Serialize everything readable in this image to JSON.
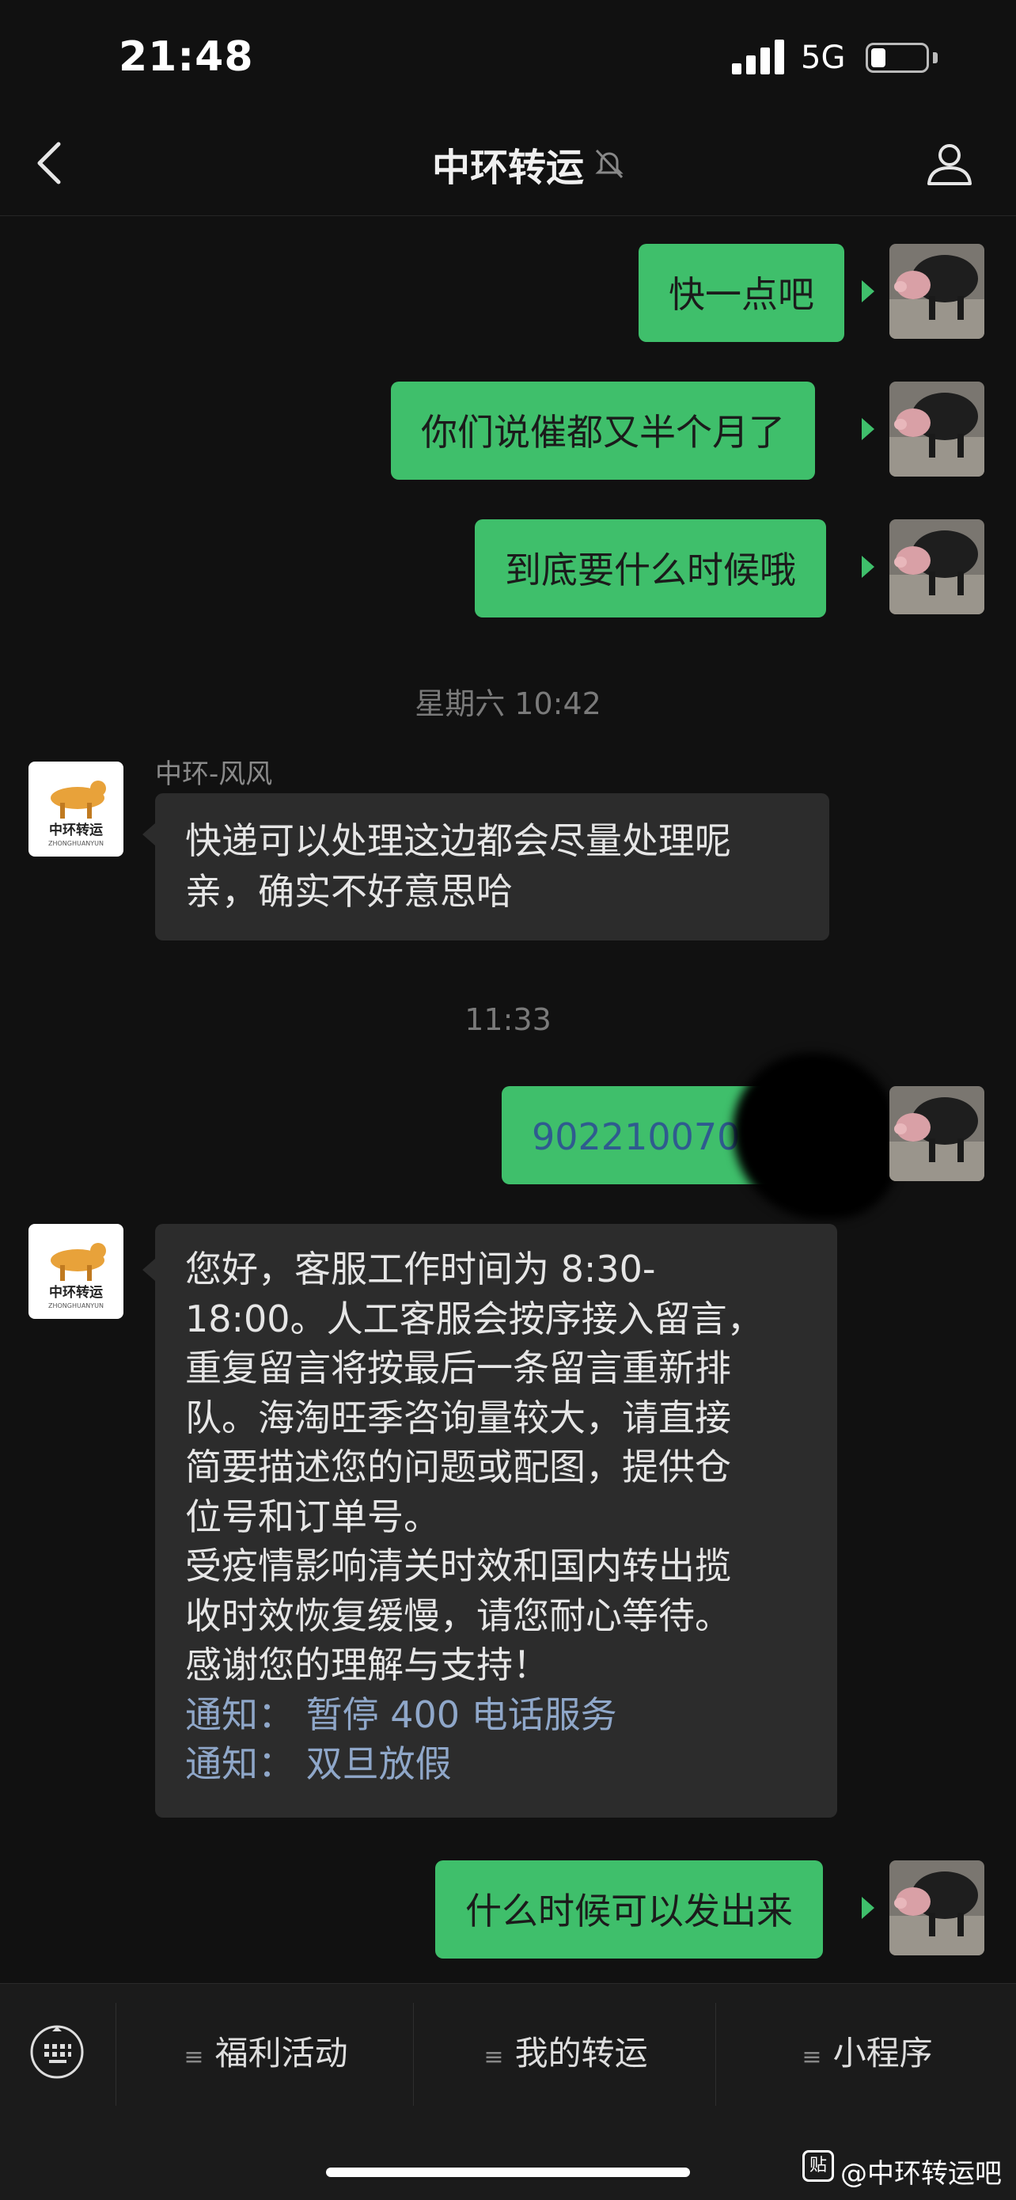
{
  "status_bar": {
    "time": "21:48",
    "network": "5G",
    "battery_level": 0.28
  },
  "nav": {
    "title": "中环转运"
  },
  "timestamps": [
    "星期六 10:42",
    "11:33"
  ],
  "messages": [
    {
      "side": "out",
      "text": "快一点吧"
    },
    {
      "side": "out",
      "text": "你们说催都又半个月了"
    },
    {
      "side": "out",
      "text": "到底要什么时候哦"
    },
    {
      "side": "in",
      "sender": "中环-风风",
      "lines": [
        "快递可以处理这边都会尽量处理呢",
        "亲，确实不好意思哈"
      ]
    },
    {
      "side": "out",
      "text": "902210070"
    },
    {
      "side": "in",
      "lines": [
        "您好，客服工作时间为 8:30-",
        "18:00。人工客服会按序接入留言，",
        "重复留言将按最后一条留言重新排",
        "队。海淘旺季咨询量较大，请直接",
        "简要描述您的问题或配图，提供仓",
        "位号和订单号。",
        "受疫情影响清关时效和国内转出揽",
        "收时效恢复缓慢，请您耐心等待。",
        "感谢您的理解与支持！"
      ],
      "links": [
        "通知：  暂停 400 电话服务",
        "通知：  双旦放假"
      ]
    },
    {
      "side": "out",
      "text": "什么时候可以发出来"
    }
  ],
  "logo": {
    "text": "中环转运",
    "subtext": "ZHONGHUANYUN"
  },
  "bottom_menu": {
    "items": [
      "福利活动",
      "我的转运",
      "小程序"
    ],
    "menu_glyph": "≡"
  },
  "watermark": {
    "glyph": "贴",
    "text": "@中环转运吧"
  },
  "colors": {
    "bubble_out": "#3fbf6b",
    "bubble_in": "#2c2c2c",
    "background": "#111111",
    "link": "#8fa7c9"
  }
}
